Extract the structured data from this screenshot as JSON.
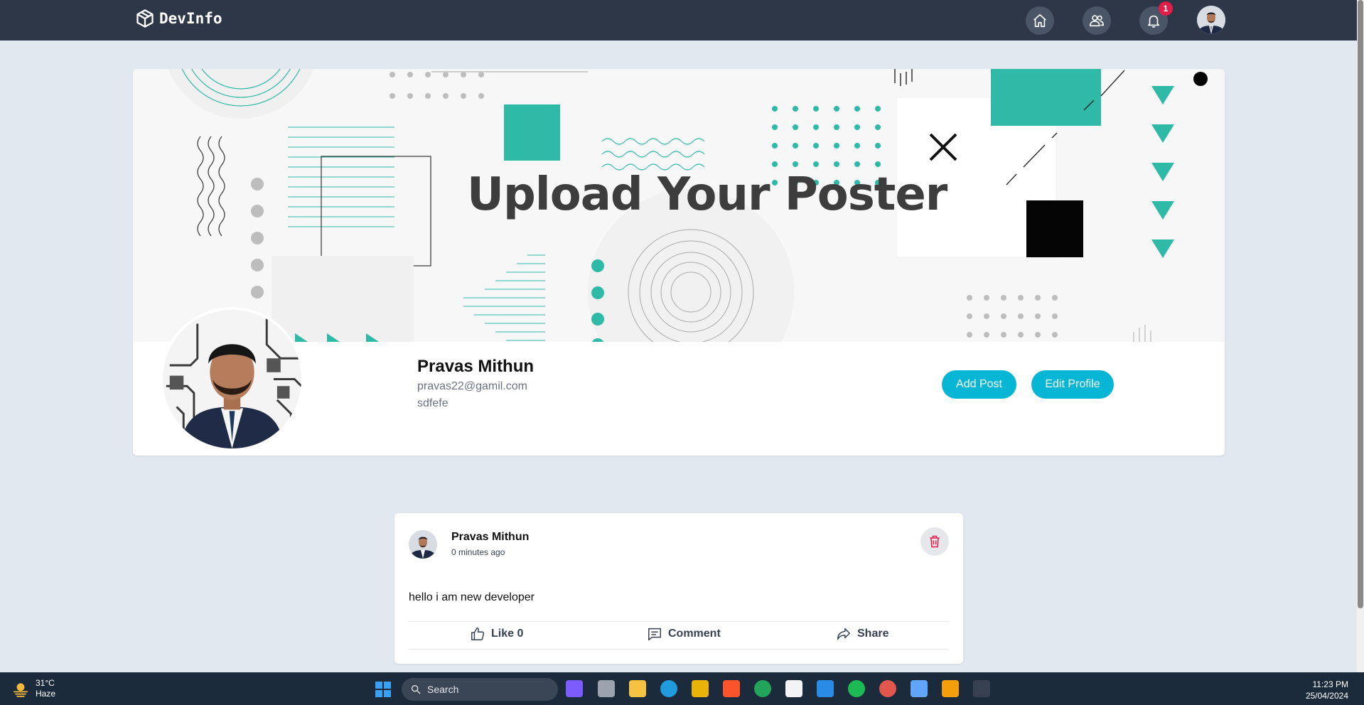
{
  "navbar": {
    "brand": "DevInfo",
    "notification_count": "1"
  },
  "profile": {
    "cover_title": "Upload Your Poster",
    "name": "Pravas Mithun",
    "email": "pravas22@gamil.com",
    "bio": "sdfefe",
    "add_post_label": "Add Post",
    "edit_profile_label": "Edit Profile"
  },
  "post": {
    "author": "Pravas Mithun",
    "time": "0 minutes ago",
    "body": "hello i am new developer",
    "like_label": "Like 0",
    "comment_label": "Comment",
    "share_label": "Share"
  },
  "taskbar": {
    "temperature": "31°C",
    "weather": "Haze",
    "search_label": "Search",
    "time": "11:23 PM",
    "date": "25/04/2024"
  },
  "colors": {
    "navbar": "#2d3748",
    "accent": "#06b6d4",
    "teal": "#2ebaa6",
    "badge": "#e11d48"
  }
}
